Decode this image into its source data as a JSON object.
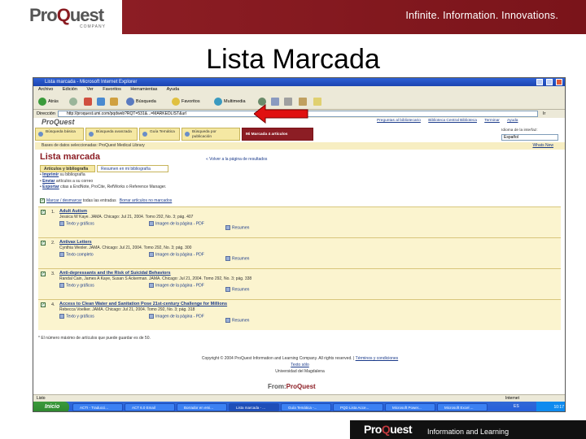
{
  "banner": {
    "logo_pro": "Pro",
    "logo_q": "Q",
    "logo_uest": "uest",
    "logo_sub": "COMPANY",
    "tagline": "Infinite. Information. Innovations."
  },
  "slide_title": "Lista Marcada",
  "window": {
    "title": "Lista marcada - Microsoft Internet Explorer",
    "menu": [
      "Archivo",
      "Edición",
      "Ver",
      "Favoritos",
      "Herramientas",
      "Ayuda"
    ],
    "toolbar": [
      "Atrás",
      "Búsqueda",
      "Favoritos",
      "Multimedia"
    ],
    "address_label": "Dirección",
    "address_value": "http://proquest.umi.com/pqdweb?RQT=531&...=MARKEDLIST&url",
    "go_label": "Ir"
  },
  "pq": {
    "logo": "ProQuest",
    "toplinks": [
      "Preguntas al bibliotecario",
      "Biblioteca Central Biblioteca",
      "Terminar",
      "Ayuda"
    ],
    "tabs": [
      "Búsqueda básica",
      "Búsqueda avanzada",
      "Guía Temática",
      "Búsqueda por publicación",
      "Mi Marcada  4 artículos"
    ],
    "lang_label": "Idioma de la interfaz:",
    "lang_value": "Español",
    "db_line": "Bases de datos seleccionadas:  ProQuest Medical Library",
    "db_right": "Whats New",
    "list_title": "Lista marcada",
    "back_link": "« Volver a la página de resultados",
    "subtabs": [
      "Artículos y bibliografía",
      "Resumen en mi bibliografía"
    ],
    "actions": [
      {
        "link": "Imprimir",
        "text": " su bibliografía"
      },
      {
        "link": "Enviar",
        "text": " artículos a su correo"
      },
      {
        "link": "Exportar",
        "text": " citas a EndNote, ProCite, RefWorks o Reference Manager."
      }
    ],
    "markall_link1": "Marcar / desmarcar",
    "markall_text": " todas las entradas",
    "markall_link2": "Borrar artículos no marcados",
    "rows": [
      {
        "num": "1.",
        "title": "Adult Autism",
        "meta": "Jessica W Kaye.  JAMA. Chicago: Jul 21, 2004. Tomo 292, No. 3; pág. 407",
        "o1": "Texto y gráficos",
        "o2": "Imagen de la página - PDF",
        "o3": "Resumen"
      },
      {
        "num": "2.",
        "title": "Antivax Letters",
        "meta": "Cynthia Wexler.  JAMA. Chicago: Jul 21, 2004. Tomo 292, No. 3; pág. 300",
        "o1": "Texto completo",
        "o2": "Imagen de la página - PDF",
        "o3": "Resumen"
      },
      {
        "num": "3.",
        "title": "Anti-depressants and the Risk of Suicidal Behaviors",
        "meta": "Randal Cain, James A Kaye, Susan S Ackerman.  JAMA. Chicago: Jul 21, 2004. Tomo 292, No. 3; pág. 338",
        "o1": "Texto y gráficos",
        "o2": "Imagen de la página - PDF",
        "o3": "Resumen"
      },
      {
        "num": "4.",
        "title": "Access to Clean Water and Sanitation Pose 21st-century Challenge for Millions",
        "meta": "Rebecca Voelker.  JAMA. Chicago: Jul 21, 2004. Tomo 292, No. 3; pág. 318",
        "o1": "Texto y gráficos",
        "o2": "Imagen de la página - PDF",
        "o3": "Resumen"
      }
    ],
    "note": "* El número máximo de artículos que puede guardar es de 50.",
    "footer_copy": "Copyright © 2004 ProQuest Information and Learning Company. All rights reserved.",
    "footer_terms": "Términos y condiciones",
    "footer_text": "Texto sólo",
    "footer_univ": "Universidad del Magdalena",
    "from_logo_from": "From:",
    "from_logo_pq": "ProQuest"
  },
  "status": {
    "left": "Listo",
    "right": "Internet"
  },
  "taskbar": {
    "start": "Inicio",
    "tasks": [
      "ACTI - Traducci...",
      "ACT 6.0 Email",
      "Borrador en emi...",
      "Lista marcada - ...",
      "Guía Temática -...",
      "PQD Lista Acce...",
      "Microsoft Power...",
      "Microsoft Excel ..."
    ],
    "lang": "ES",
    "clock": "10:17"
  },
  "foot": {
    "logo_pro": "Pro",
    "logo_q": "Q",
    "logo_uest": "uest",
    "tagline": "Information and Learning"
  }
}
